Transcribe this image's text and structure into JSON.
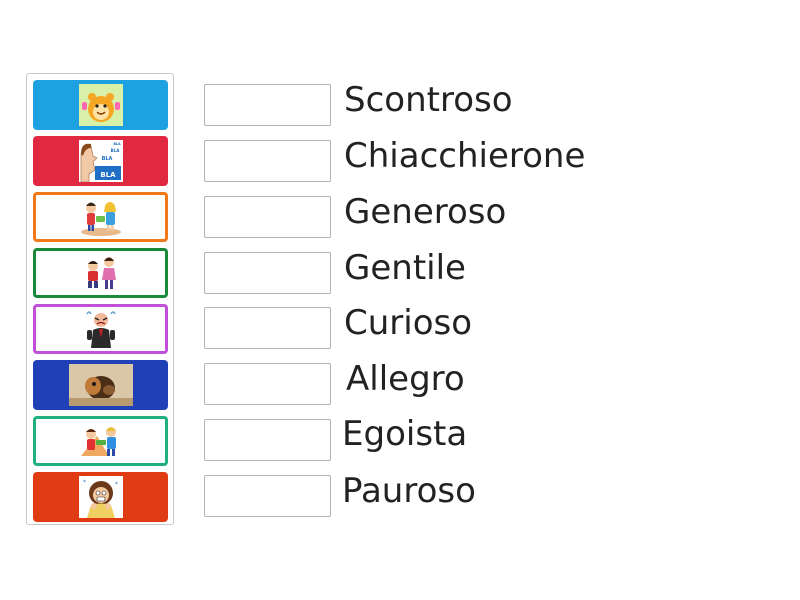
{
  "words": [
    {
      "label": "Scontroso"
    },
    {
      "label": "Chiacchierone"
    },
    {
      "label": "Generoso"
    },
    {
      "label": "Gentile"
    },
    {
      "label": "Curioso"
    },
    {
      "label": "Allegro"
    },
    {
      "label": "Egoista"
    },
    {
      "label": "Pauroso"
    }
  ],
  "tiles": [
    {
      "picture": "happy-hamster",
      "style": "filled",
      "color": "#1da1e0"
    },
    {
      "picture": "talking-head-bla-bla",
      "style": "filled",
      "color": "#e02840"
    },
    {
      "picture": "children-sharing",
      "style": "outlined",
      "color": "#f07818"
    },
    {
      "picture": "child-helping-friend",
      "style": "outlined",
      "color": "#1a8a3a"
    },
    {
      "picture": "angry-man",
      "style": "outlined",
      "color": "#c050d8"
    },
    {
      "picture": "peeking-through-hole",
      "style": "filled",
      "color": "#2040b8"
    },
    {
      "picture": "kids-arguing-over-toy",
      "style": "outlined",
      "color": "#20b080"
    },
    {
      "picture": "frightened-woman",
      "style": "filled",
      "color": "#e03c14"
    }
  ],
  "icon_image_text": [
    "BLA",
    "BLA",
    "BLA",
    "BLA"
  ]
}
